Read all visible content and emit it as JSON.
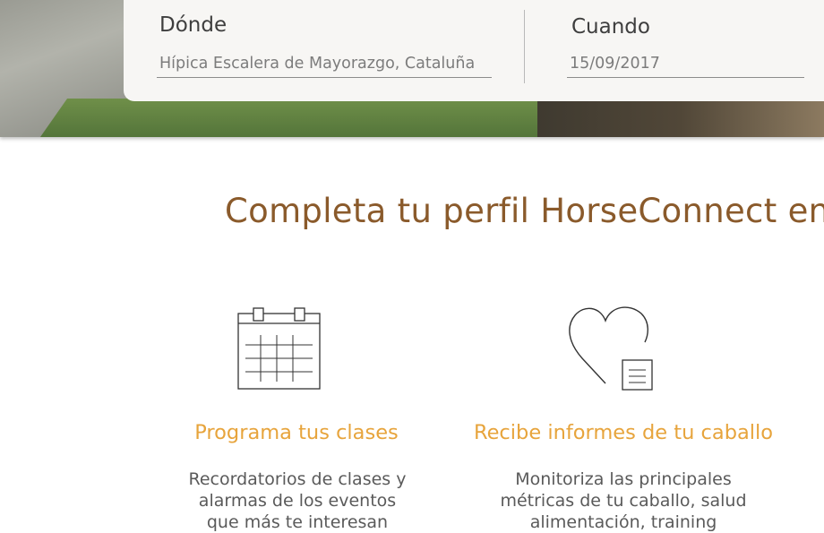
{
  "booking": {
    "where": {
      "label": "Dónde",
      "value": "Hípica Escalera de Mayorazgo, Cataluña"
    },
    "when": {
      "label": "Cuando",
      "value": "15/09/2017"
    }
  },
  "headline": "Completa tu perfil HorseConnect en",
  "features": [
    {
      "icon": "calendar-icon",
      "title": "Programa tus clases",
      "description": [
        "Recordatorios de clases y",
        "alarmas de los eventos",
        "que más te interesan"
      ]
    },
    {
      "icon": "heart-report-icon",
      "title": "Recibe informes de tu caballo",
      "description": [
        "Monitoriza las principales",
        "métricas de tu caballo, salud",
        "alimentación, training"
      ]
    }
  ],
  "colors": {
    "headline": "#8a5a2b",
    "feature_title": "#e7a43c",
    "card_bg": "#f7f6f4"
  }
}
